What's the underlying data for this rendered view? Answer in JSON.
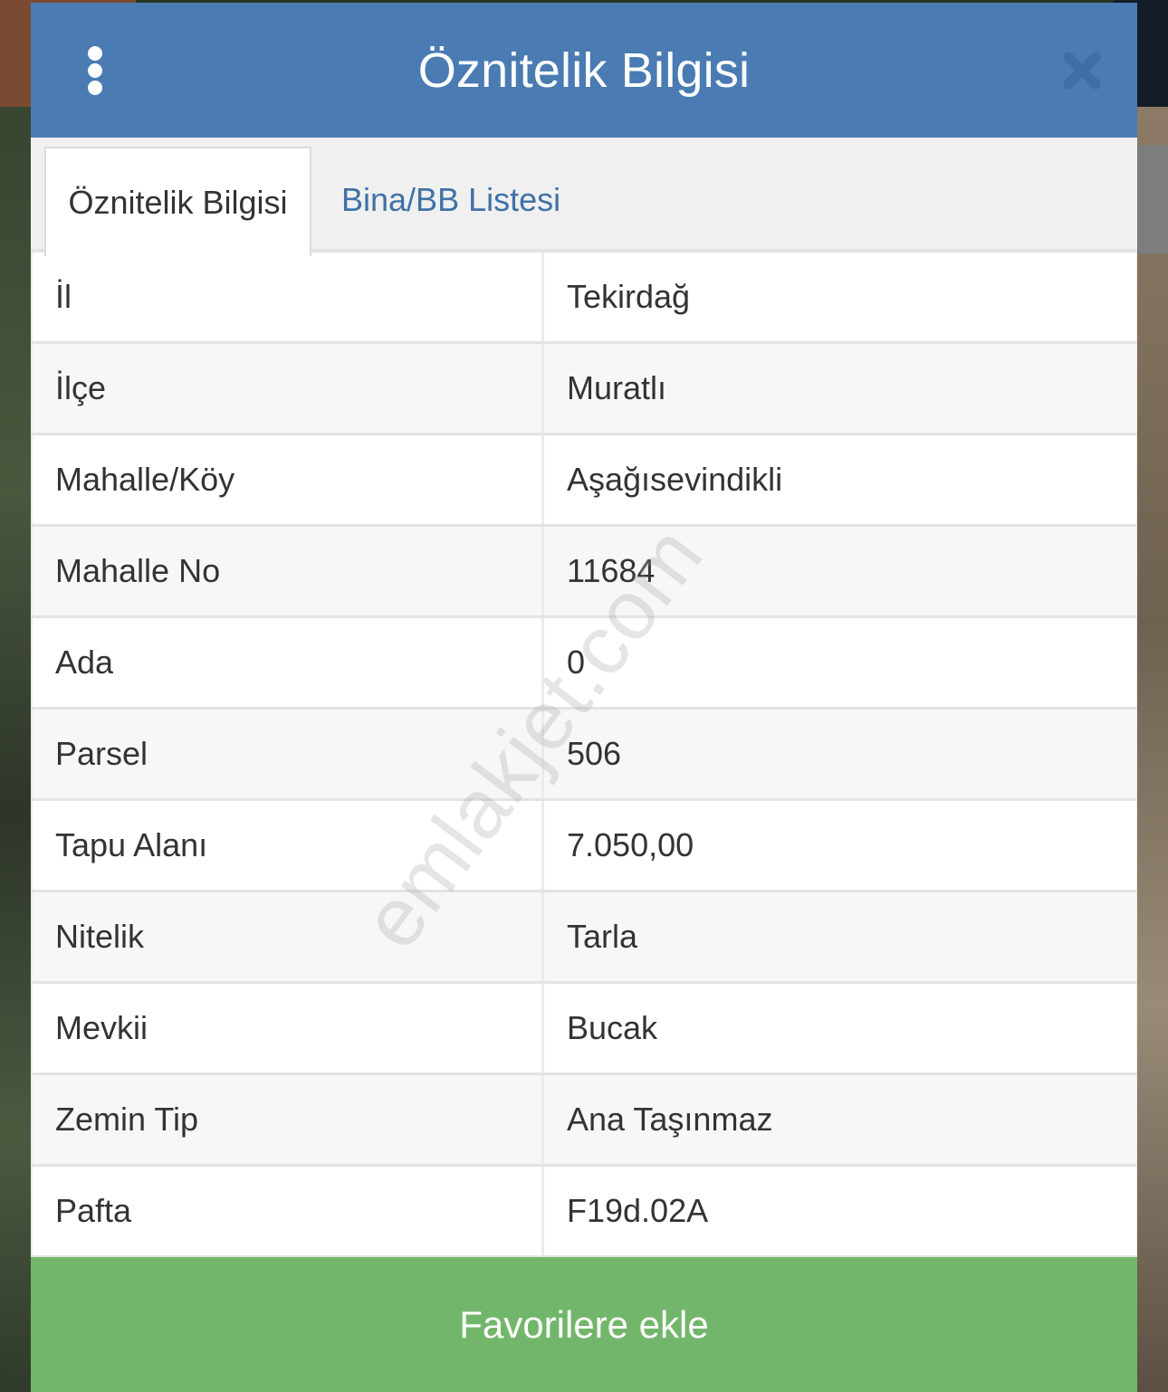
{
  "header": {
    "title": "Öznitelik Bilgisi"
  },
  "tabs": [
    {
      "label": "Öznitelik Bilgisi",
      "active": true
    },
    {
      "label": "Bina/BB Listesi",
      "active": false
    }
  ],
  "attributes": [
    {
      "key": "İl",
      "value": "Tekirdağ"
    },
    {
      "key": "İlçe",
      "value": "Muratlı"
    },
    {
      "key": "Mahalle/Köy",
      "value": "Aşağısevindikli"
    },
    {
      "key": "Mahalle No",
      "value": "11684"
    },
    {
      "key": "Ada",
      "value": "0"
    },
    {
      "key": "Parsel",
      "value": "506"
    },
    {
      "key": "Tapu Alanı",
      "value": "7.050,00"
    },
    {
      "key": "Nitelik",
      "value": "Tarla"
    },
    {
      "key": "Mevkii",
      "value": "Bucak"
    },
    {
      "key": "Zemin Tip",
      "value": "Ana Taşınmaz"
    },
    {
      "key": "Pafta",
      "value": "F19d.02A"
    }
  ],
  "watermark": "emlakjet.com",
  "actions": {
    "favorite_label": "Favorilere ekle"
  },
  "icons": {
    "menu": "vertical-dots-icon",
    "close": "close-icon"
  },
  "colors": {
    "header": "#4a7bb3",
    "tab_link": "#3f72a6",
    "button": "#72b66b",
    "close_icon": "#3e6ea6"
  }
}
